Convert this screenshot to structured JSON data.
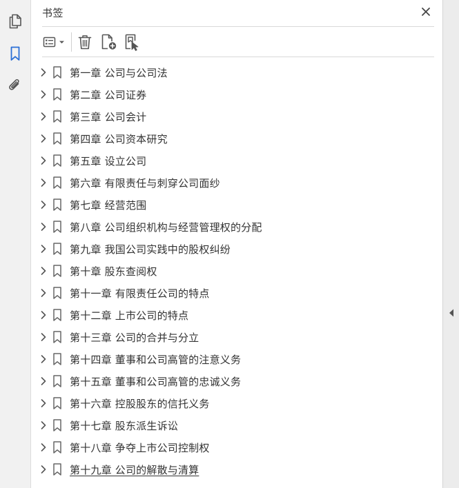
{
  "panel": {
    "title": "书签"
  },
  "rail": {
    "items": [
      {
        "icon": "pages-icon",
        "name": "页面缩略图"
      },
      {
        "icon": "bookmark-icon",
        "name": "书签",
        "active": true
      },
      {
        "icon": "paperclip-icon",
        "name": "附件"
      }
    ]
  },
  "toolbar": {
    "items": [
      {
        "icon": "options-menu-icon"
      },
      {
        "icon": "trash-icon"
      },
      {
        "icon": "new-bookmark-icon"
      },
      {
        "icon": "bookmark-from-structure-icon"
      }
    ]
  },
  "bookmarks": [
    {
      "label": "第一章  公司与公司法"
    },
    {
      "label": "第二章  公司证券"
    },
    {
      "label": "第三章  公司会计"
    },
    {
      "label": "第四章  公司资本研究"
    },
    {
      "label": "第五章  设立公司"
    },
    {
      "label": "第六章  有限责任与刺穿公司面纱"
    },
    {
      "label": "第七章  经营范围"
    },
    {
      "label": "第八章  公司组织机构与经营管理权的分配"
    },
    {
      "label": "第九章  我国公司实践中的股权纠纷"
    },
    {
      "label": "第十章  股东查阅权"
    },
    {
      "label": "第十一章  有限责任公司的特点"
    },
    {
      "label": "第十二章  上市公司的特点"
    },
    {
      "label": "第十三章  公司的合并与分立"
    },
    {
      "label": "第十四章  董事和公司高管的注意义务"
    },
    {
      "label": "第十五章  董事和公司高管的忠诚义务"
    },
    {
      "label": "第十六章  控股股东的信托义务"
    },
    {
      "label": "第十七章  股东派生诉讼"
    },
    {
      "label": "第十八章  争夺上市公司控制权"
    },
    {
      "label": "第十九章  公司的解散与清算",
      "active": true
    }
  ],
  "colors": {
    "accent": "#2a6fd6",
    "icon": "#555555",
    "rail_bg": "#f1f1f1"
  }
}
